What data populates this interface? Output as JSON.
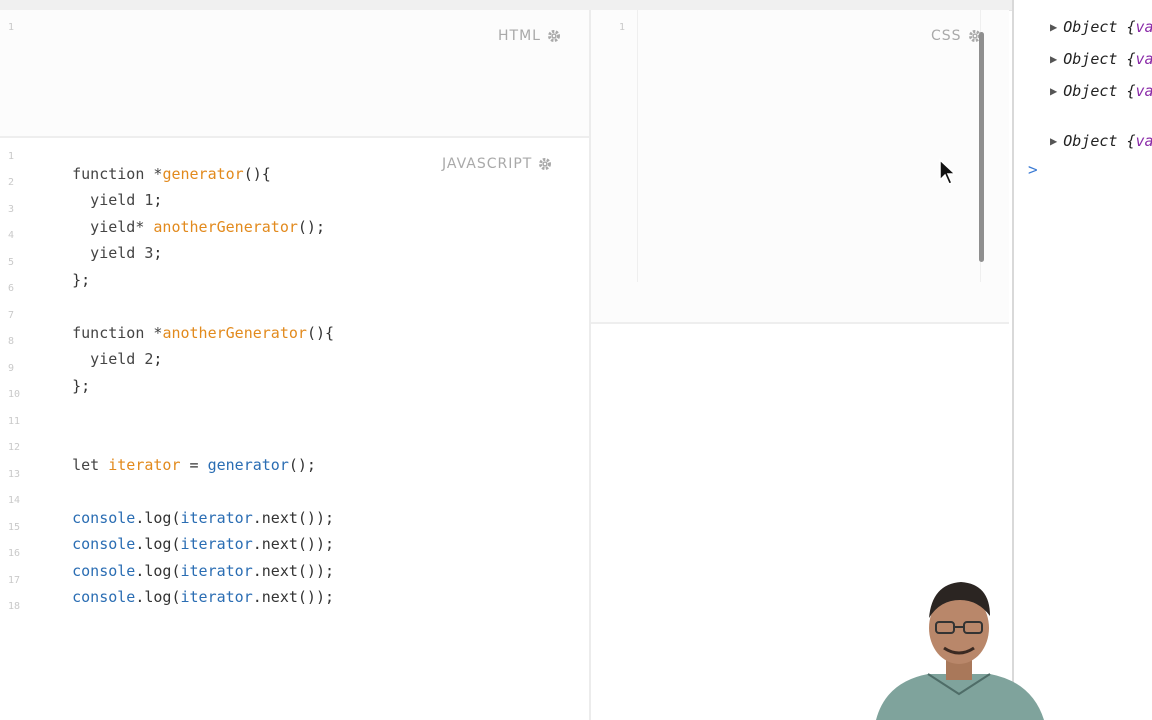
{
  "panels": {
    "html_label": "HTML",
    "css_label": "CSS",
    "js_label": "JAVASCRIPT"
  },
  "html_panel": {
    "line_numbers": [
      "1"
    ]
  },
  "css_panel": {
    "line_numbers": [
      "1"
    ]
  },
  "js_editor": {
    "line_numbers": [
      "1",
      "2",
      "3",
      "4",
      "5",
      "6",
      "7",
      "8",
      "9",
      "10",
      "11",
      "12",
      "13",
      "14",
      "15",
      "16",
      "17",
      "18"
    ],
    "lines": {
      "l1": [
        "function",
        " *",
        "generator",
        "(){"
      ],
      "l2": [
        "  yield ",
        "1",
        ";"
      ],
      "l3": [
        "  yield* ",
        "anotherGenerator",
        "();"
      ],
      "l4": [
        "  yield ",
        "3",
        ";"
      ],
      "l5": [
        "};"
      ],
      "l7": [
        "function",
        " *",
        "anotherGenerator",
        "(){"
      ],
      "l8": [
        "  yield ",
        "2",
        ";"
      ],
      "l9": [
        "};"
      ],
      "l12": [
        "let ",
        "iterator",
        " = ",
        "generator",
        "();"
      ],
      "l14": [
        "console",
        ".log(",
        "iterator",
        ".next());"
      ],
      "l15": [
        "console",
        ".log(",
        "iterator",
        ".next());"
      ],
      "l16": [
        "console",
        ".log(",
        "iterator",
        ".next());"
      ],
      "l17": [
        "console",
        ".log(",
        "iterator",
        ".next());"
      ]
    }
  },
  "console": {
    "rows": [
      {
        "prefix": "Object",
        "brace": " {",
        "value": "va"
      },
      {
        "prefix": "Object",
        "brace": " {",
        "value": "va"
      },
      {
        "prefix": "Object",
        "brace": " {",
        "value": "va"
      },
      {
        "prefix": "Object",
        "brace": " {",
        "value": "va"
      }
    ],
    "prompt": ">"
  },
  "colors": {
    "function_name": "#e28a1d",
    "variable": "#2a6db3",
    "console_value": "#8a2aa8",
    "prompt": "#3b7bd4"
  },
  "icons": [
    "gear-icon",
    "gear-icon",
    "gear-icon",
    "expand-triangle-icon",
    "console-prompt-icon",
    "mouse-cursor-icon"
  ]
}
